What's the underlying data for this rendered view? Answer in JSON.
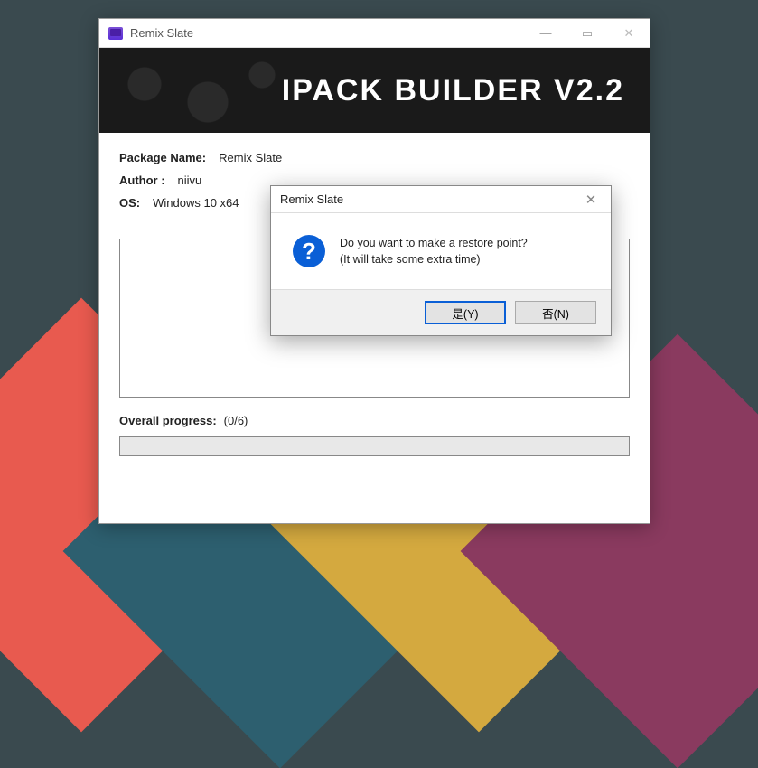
{
  "window": {
    "title": "Remix Slate"
  },
  "banner": {
    "title": "IPACK  BUILDER  V2.2"
  },
  "info": {
    "package_label": "Package Name:",
    "package_value": "Remix Slate",
    "author_label": "Author :",
    "author_value": "niivu",
    "os_label": "OS:",
    "os_value": "Windows 10 x64"
  },
  "progress": {
    "label": "Overall progress:",
    "value": "(0/6)"
  },
  "dialog": {
    "title": "Remix Slate",
    "line1": "Do you want to make a restore point?",
    "line2": "(It will take some extra time)",
    "yes_label": "是(Y)",
    "no_label": "否(N)",
    "icon_glyph": "?"
  },
  "win_controls": {
    "min": "—",
    "max": "▭",
    "close": "✕"
  }
}
